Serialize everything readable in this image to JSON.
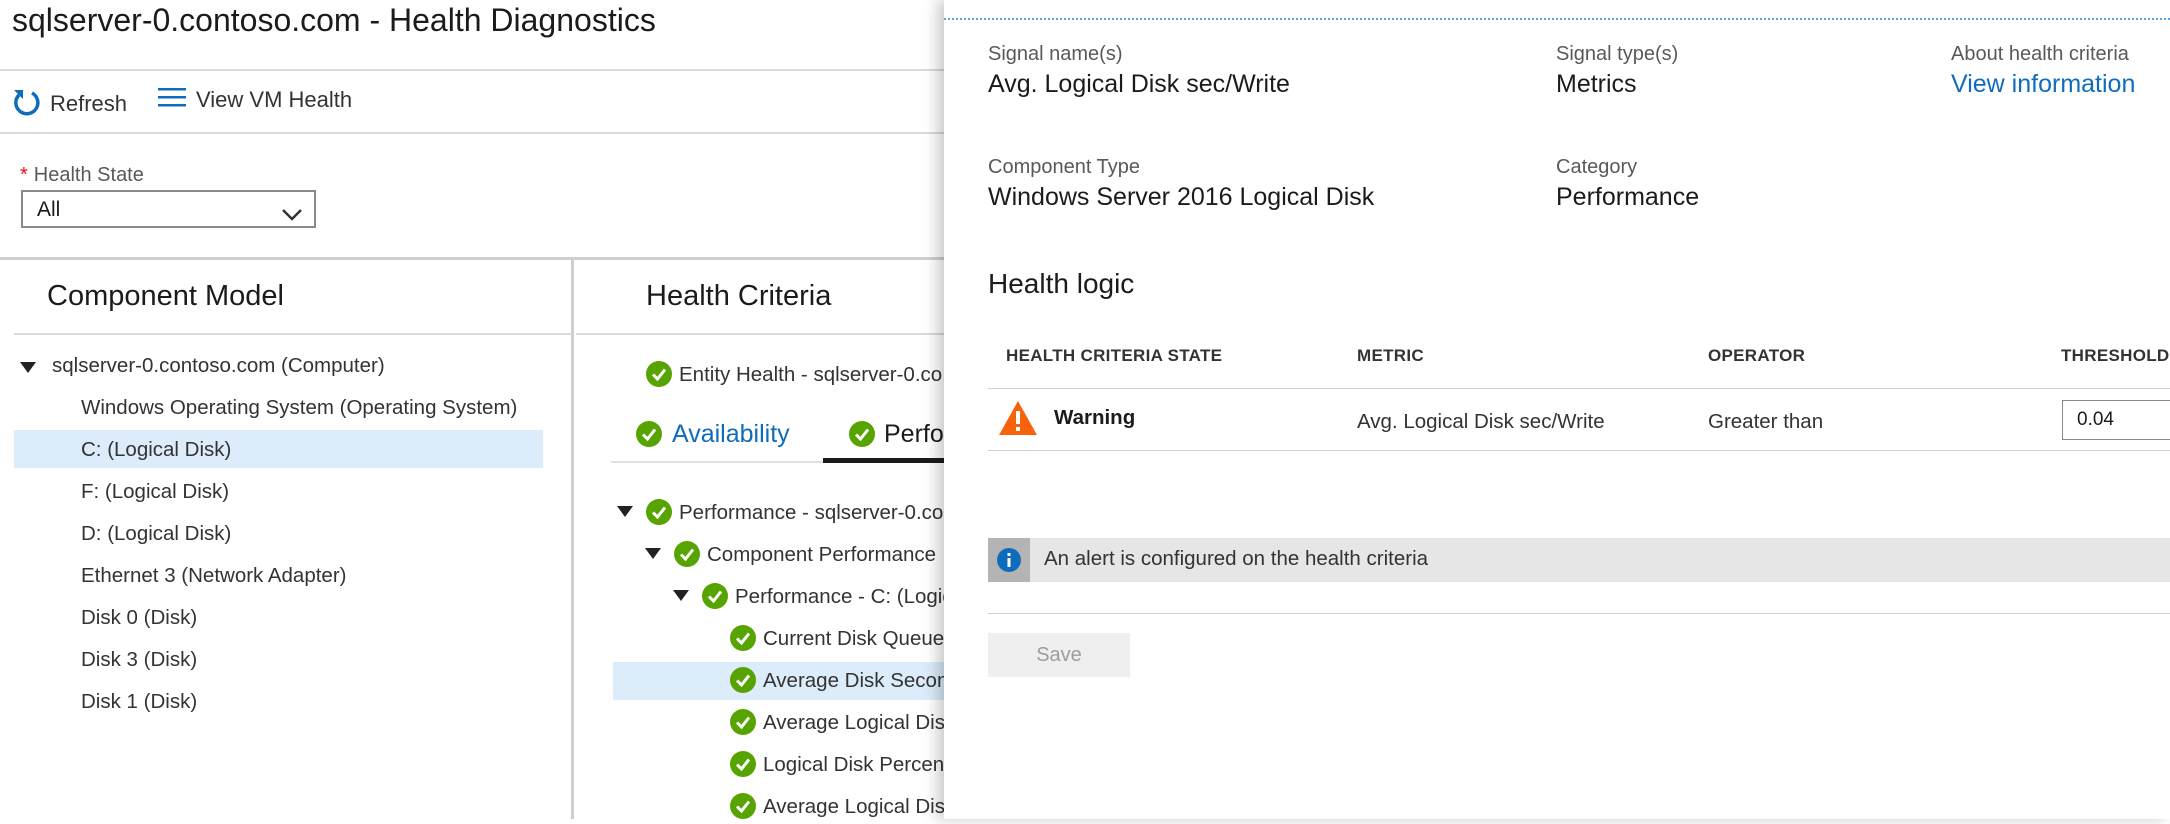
{
  "window": {
    "title": "sqlserver-0.contoso.com - Health Diagnostics"
  },
  "toolbar": {
    "refresh_label": "Refresh",
    "view_vm_health_label": "View VM Health"
  },
  "filter": {
    "label": "Health State",
    "required_marker": "*",
    "selected": "All"
  },
  "component_model": {
    "heading": "Component Model",
    "root": "sqlserver-0.contoso.com (Computer)",
    "items": [
      "Windows Operating System (Operating System)",
      "C: (Logical Disk)",
      "F: (Logical Disk)",
      "D: (Logical Disk)",
      "Ethernet 3 (Network Adapter)",
      "Disk 0 (Disk)",
      "Disk 3 (Disk)",
      "Disk 1 (Disk)"
    ],
    "selected_index": 1
  },
  "health_criteria": {
    "heading": "Health Criteria",
    "entity_health": "Entity Health - sqlserver-0.co",
    "tabs": [
      "Availability",
      "Perfo"
    ],
    "active_tab": 1,
    "tree": [
      "Performance - sqlserver-0.co",
      "Component Performance",
      "Performance - C: (Logic",
      "Current Disk Queue",
      "Average Disk Secon",
      "Average Logical Dis",
      "Logical Disk Percent",
      "Average Logical Dis"
    ]
  },
  "detail": {
    "signal_name_label": "Signal name(s)",
    "signal_name": "Avg. Logical Disk sec/Write",
    "signal_type_label": "Signal type(s)",
    "signal_type": "Metrics",
    "about_label": "About health criteria",
    "about_link": "View information",
    "component_type_label": "Component Type",
    "component_type": "Windows Server 2016 Logical Disk",
    "category_label": "Category",
    "category": "Performance",
    "health_logic_heading": "Health logic",
    "table": {
      "headers": [
        "HEALTH CRITERIA STATE",
        "METRIC",
        "OPERATOR",
        "THRESHOLD"
      ],
      "row": {
        "state": "Warning",
        "metric": "Avg. Logical Disk sec/Write",
        "operator": "Greater than",
        "threshold": "0.04"
      }
    },
    "info_message": "An alert is configured on the health criteria",
    "save_label": "Save"
  },
  "colors": {
    "accent": "#0f6cbd",
    "success": "#57a300",
    "warning": "#f7630c",
    "selection": "#dcecfb"
  }
}
